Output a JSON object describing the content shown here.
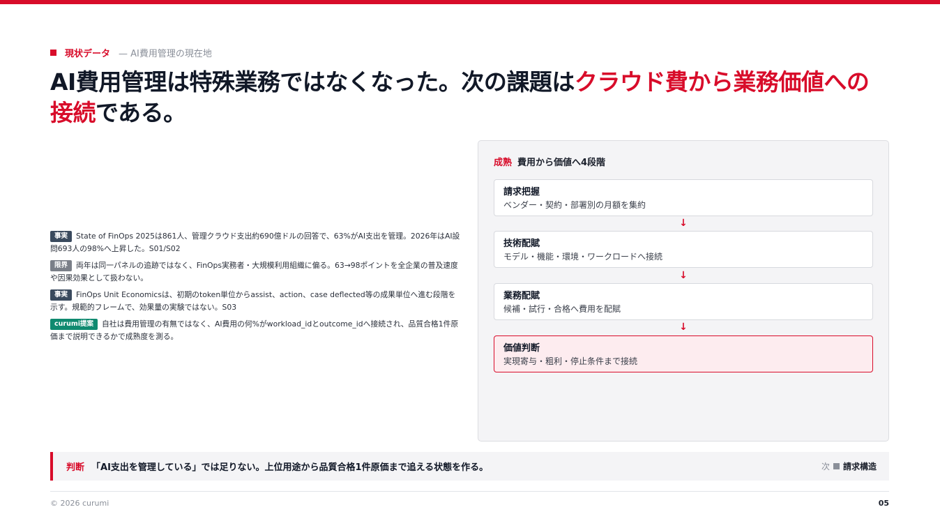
{
  "eyebrow": {
    "label": "現状データ",
    "sub": "— AI費用管理の現在地"
  },
  "headline": {
    "part1": "AI費用管理は特殊業務ではなくなった。次の課題は",
    "highlight": "クラウド費から業務価値への接続",
    "part2": "である。"
  },
  "notes": [
    {
      "tag": "事実",
      "text": "State of FinOps 2025は861人、管理クラウド支出約690億ドルの回答で、63%がAI支出を管理。2026年はAI設問693人の98%へ上昇した。S01/S02"
    },
    {
      "tag": "限界",
      "text": "両年は同一パネルの追跡ではなく、FinOps実務者・大規模利用組織に偏る。63→98ポイントを全企業の普及速度や因果効果として扱わない。"
    },
    {
      "tag": "事実",
      "text": "FinOps Unit Economicsは、初期のtoken単位からassist、action、case deflected等の成果単位へ進む段階を示す。規範的フレームで、効果量の実験ではない。S03"
    },
    {
      "tag": "curumi提案",
      "text": "自社は費用管理の有無ではなく、AI費用の何%がworkload_idとoutcome_idへ接続され、品質合格1件原価まで説明できるかで成熟度を測る。"
    }
  ],
  "panel": {
    "label": "成熟",
    "title": "費用から価値へ4段階",
    "arrow": "↓",
    "steps": [
      {
        "title": "請求把握",
        "desc": "ベンダー・契約・部署別の月額を集約"
      },
      {
        "title": "技術配賦",
        "desc": "モデル・機能・環境・ワークロードへ接続"
      },
      {
        "title": "業務配賦",
        "desc": "候補・試行・合格へ費用を配賦"
      },
      {
        "title": "価値判断",
        "desc": "実現寄与・粗利・停止条件まで接続"
      }
    ]
  },
  "judgement": {
    "label": "判断",
    "text": "「AI支出を管理している」では足りない。上位用途から品質合格1件原価まで追える状態を作る。"
  },
  "next": {
    "label": "次",
    "title": "請求構造"
  },
  "footer": {
    "copyright": "© 2026 curumi",
    "page": "05"
  },
  "colors": {
    "accent": "#d80c2a",
    "fact_tag": "#3a4a5e",
    "limit_tag": "#7a7f88",
    "proposal_tag": "#0f8a70"
  }
}
